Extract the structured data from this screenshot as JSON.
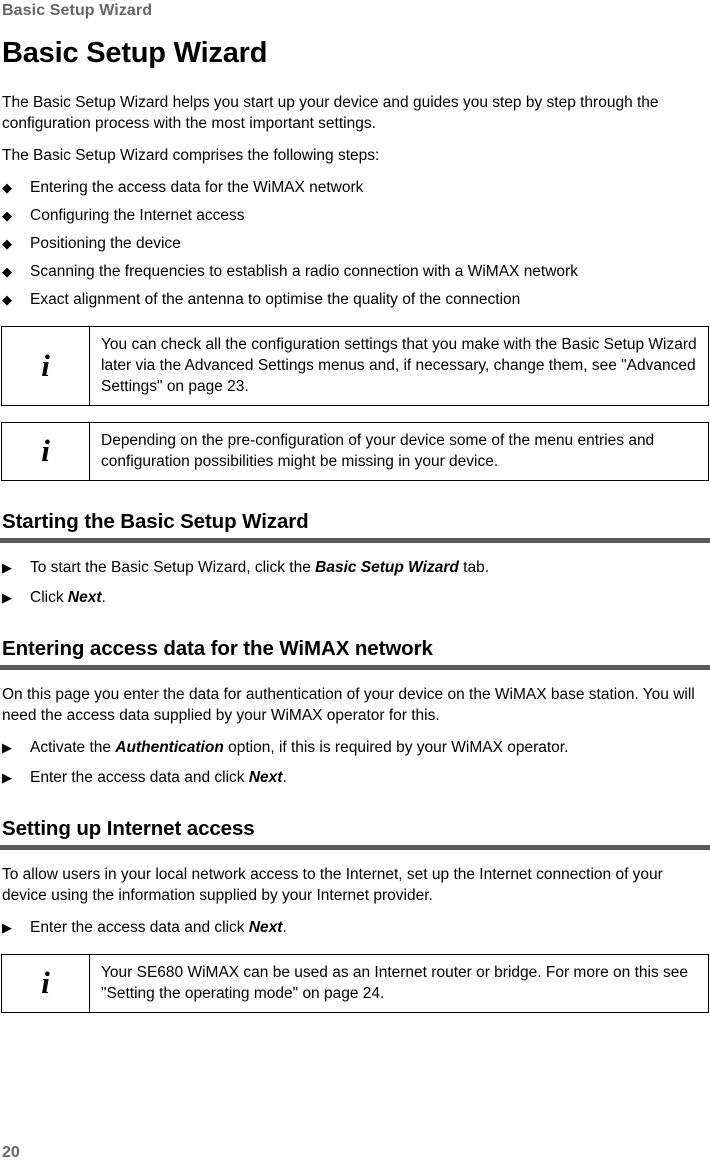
{
  "running_header": "Basic Setup Wizard",
  "page_number": "20",
  "title": "Basic Setup Wizard",
  "intro_paragraph": "The Basic Setup Wizard helps you start up your device and guides you step by step through the configuration process with the most important settings.",
  "steps_lead_in": "The Basic Setup Wizard comprises the following steps:",
  "bullet_icon": "◆",
  "step_icon": "▶",
  "note_icon": "i",
  "steps": [
    "Entering the access data for the WiMAX network",
    "Configuring the Internet access",
    "Positioning the device",
    "Scanning the frequencies to establish a radio connection with a WiMAX network",
    "Exact alignment of the antenna to optimise the quality of the connection"
  ],
  "note_1": "You can check all the configuration settings that you make with the Basic Setup Wizard later via the Advanced Settings menus and, if necessary, change them, see \"Advanced Settings\" on page 23.",
  "note_2": "Depending on the pre-configuration of your device some of the menu entries and configuration possibilities might be missing in your device.",
  "section_starting": {
    "heading": "Starting the Basic Setup Wizard",
    "step_1_prefix": "To start the Basic Setup Wizard, click the ",
    "step_1_emphasis": "Basic Setup Wizard",
    "step_1_suffix": " tab.",
    "step_2_prefix": "Click ",
    "step_2_emphasis": "Next",
    "step_2_suffix": "."
  },
  "section_entering": {
    "heading": "Entering access data for the WiMAX network",
    "paragraph": "On this page you enter the data for authentication of your device on the WiMAX base station. You will need the access data supplied by your WiMAX operator for this.",
    "step_1_prefix": "Activate the ",
    "step_1_emphasis": "Authentication",
    "step_1_suffix": " option, if this is required by your WiMAX operator.",
    "step_2_prefix": "Enter the access data and click ",
    "step_2_emphasis": "Next",
    "step_2_suffix": "."
  },
  "section_internet": {
    "heading": "Setting up Internet access",
    "paragraph": "To allow users in your local network access to the Internet, set up the Internet connection of your device using the information supplied by your Internet provider.",
    "step_1_prefix": "Enter the access data and click ",
    "step_1_emphasis": "Next",
    "step_1_suffix": "."
  },
  "note_3": "Your SE680 WiMAX can be used as an Internet router or bridge. For more on this see \"Setting the operating mode\" on page 24.",
  "colors": {
    "header_gray": "#666666",
    "rule_bar_gray": "#595959",
    "text_black": "#000000",
    "page_background": "#ffffff"
  }
}
